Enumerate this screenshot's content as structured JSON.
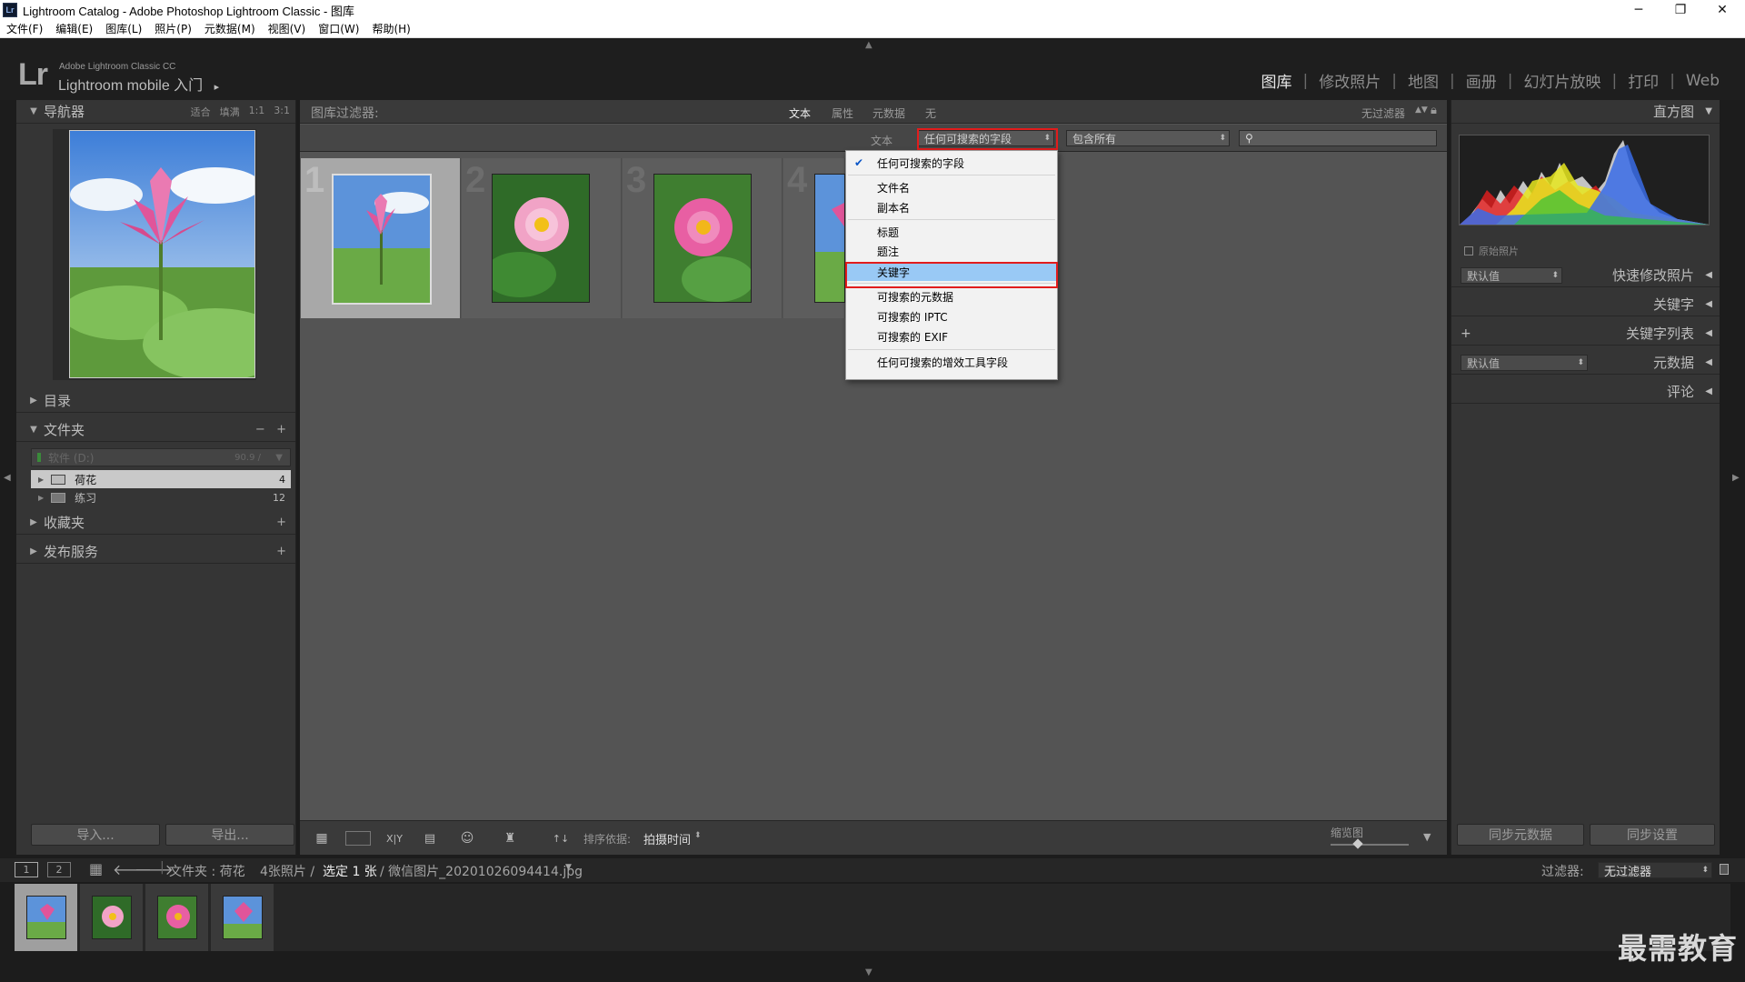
{
  "window": {
    "title": "Lightroom Catalog - Adobe Photoshop Lightroom Classic - 图库",
    "app_icon": "Lr",
    "controls": [
      "minimize-icon",
      "maximize-icon",
      "close-icon"
    ]
  },
  "menu": [
    "文件(F)",
    "编辑(E)",
    "图库(L)",
    "照片(P)",
    "元数据(M)",
    "视图(V)",
    "窗口(W)",
    "帮助(H)"
  ],
  "identity": {
    "logo": "Lr",
    "product": "Adobe Lightroom Classic CC",
    "mobile": "Lightroom mobile 入门",
    "mobile_arrow": "▸"
  },
  "modules": [
    "图库",
    "修改照片",
    "地图",
    "画册",
    "幻灯片放映",
    "打印",
    "Web"
  ],
  "modules_active": "图库",
  "left": {
    "navigator": {
      "title": "导航器",
      "opts": [
        "适合",
        "填满",
        "1:1",
        "3:1"
      ]
    },
    "catalog": "目录",
    "folders": {
      "title": "文件夹",
      "volume": "软件 (D:)",
      "volume_size": "90.9 /",
      "items": [
        {
          "name": "荷花",
          "count": "4"
        },
        {
          "name": "练习",
          "count": "12"
        }
      ]
    },
    "collections": "收藏夹",
    "publish": "发布服务",
    "import_btn": "导入...",
    "export_btn": "导出..."
  },
  "filter": {
    "label": "图库过滤器:",
    "tabs": [
      "文本",
      "属性",
      "元数据",
      "无"
    ],
    "active_tab": "文本",
    "preset": "无过滤器",
    "text_label": "文本",
    "field_select": "任何可搜索的字段",
    "rule_select": "包含所有"
  },
  "dropdown": {
    "items": [
      {
        "label": "任何可搜索的字段",
        "checked": true,
        "highlighted": false
      },
      {
        "label": "文件名"
      },
      {
        "label": "副本名"
      },
      {
        "label": "标题"
      },
      {
        "label": "题注"
      },
      {
        "label": "关键字",
        "highlighted": true
      },
      {
        "label": "可搜索的元数据"
      },
      {
        "label": "可搜索的 IPTC"
      },
      {
        "label": "可搜索的 EXIF"
      },
      {
        "label": "任何可搜索的增效工具字段"
      }
    ]
  },
  "grid": {
    "cells": [
      "1",
      "2",
      "3",
      "4"
    ],
    "selected": "1"
  },
  "toolbar": {
    "sort_label": "排序依据:",
    "sort_value": "拍摄时间",
    "thumb_label": "缩览图"
  },
  "right": {
    "histogram": "直方图",
    "original": "原始照片",
    "quick_develop": "快速修改照片",
    "preset_default": "默认值",
    "keywording": "关键字",
    "keyword_list": "关键字列表",
    "metadata": "元数据",
    "metadata_default": "默认值",
    "comments": "评论",
    "sync_meta": "同步元数据",
    "sync_settings": "同步设置"
  },
  "filmstrip": {
    "screen1": "1",
    "screen2": "2",
    "path_prefix": "文件夹 : 荷花",
    "count": "4张照片 /",
    "selected": "选定 1 张",
    "filename": "/ 微信图片_20201026094414.jpg",
    "filter_label": "过滤器:",
    "filter_value": "无过滤器"
  },
  "watermark": "最需教育",
  "colors": {
    "highlight": "#99c9f5",
    "red_outline": "#e21c1c",
    "lotus_pink": "#e0559a"
  }
}
